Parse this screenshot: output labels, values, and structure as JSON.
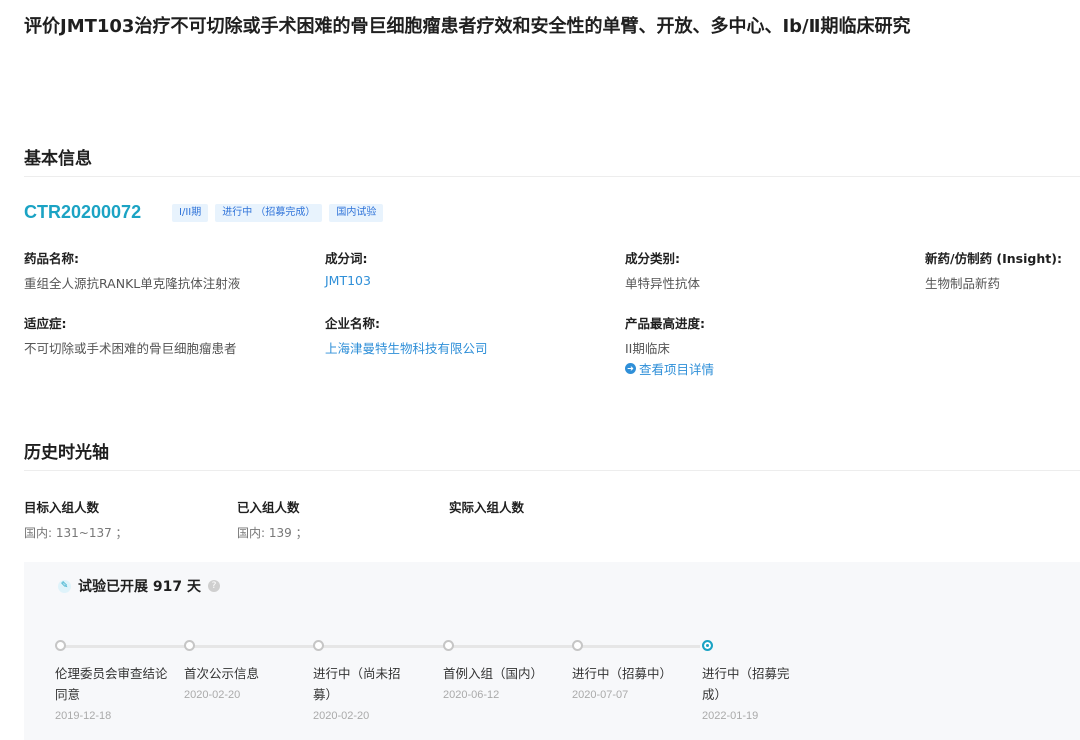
{
  "page_title": "评价JMT103治疗不可切除或手术困难的骨巨细胞瘤患者疗效和安全性的单臂、开放、多中心、Ⅰb/Ⅱ期临床研究",
  "basic_info": {
    "section_title": "基本信息",
    "trial_id": "CTR20200072",
    "tags": [
      "I/II期",
      "进行中 （招募完成）",
      "国内试验"
    ],
    "fields": {
      "drug_name": {
        "label": "药品名称:",
        "value": "重组全人源抗RANKL单克隆抗体注射液"
      },
      "component": {
        "label": "成分词:",
        "value": "JMT103"
      },
      "component_type": {
        "label": "成分类别:",
        "value": "单特异性抗体"
      },
      "new_drug": {
        "label": "新药/仿制药 (Insight):",
        "value": "生物制品新药"
      },
      "indication": {
        "label": "适应症:",
        "value": "不可切除或手术困难的骨巨细胞瘤患者"
      },
      "company": {
        "label": "企业名称:",
        "value": "上海津曼特生物科技有限公司"
      },
      "highest_stage": {
        "label": "产品最高进度:",
        "value": "II期临床",
        "link": "查看项目详情"
      }
    }
  },
  "history": {
    "section_title": "历史时光轴",
    "enrollment": [
      {
        "label": "目标入组人数",
        "value": "国内: 131~137 ；"
      },
      {
        "label": "已入组人数",
        "value": "国内: 139 ；"
      },
      {
        "label": "实际入组人数",
        "value": ""
      }
    ],
    "progress_prefix": "试验已开展 917 天",
    "milestones": [
      {
        "label": "伦理委员会审查结论同意",
        "date": "2019-12-18",
        "active": false
      },
      {
        "label": "首次公示信息",
        "date": "2020-02-20",
        "active": false
      },
      {
        "label": "进行中（尚未招募）",
        "date": "2020-02-20",
        "active": false
      },
      {
        "label": "首例入组（国内）",
        "date": "2020-06-12",
        "active": false
      },
      {
        "label": "进行中（招募中）",
        "date": "2020-07-07",
        "active": false
      },
      {
        "label": "进行中（招募完成）",
        "date": "2022-01-19",
        "active": true
      }
    ]
  }
}
